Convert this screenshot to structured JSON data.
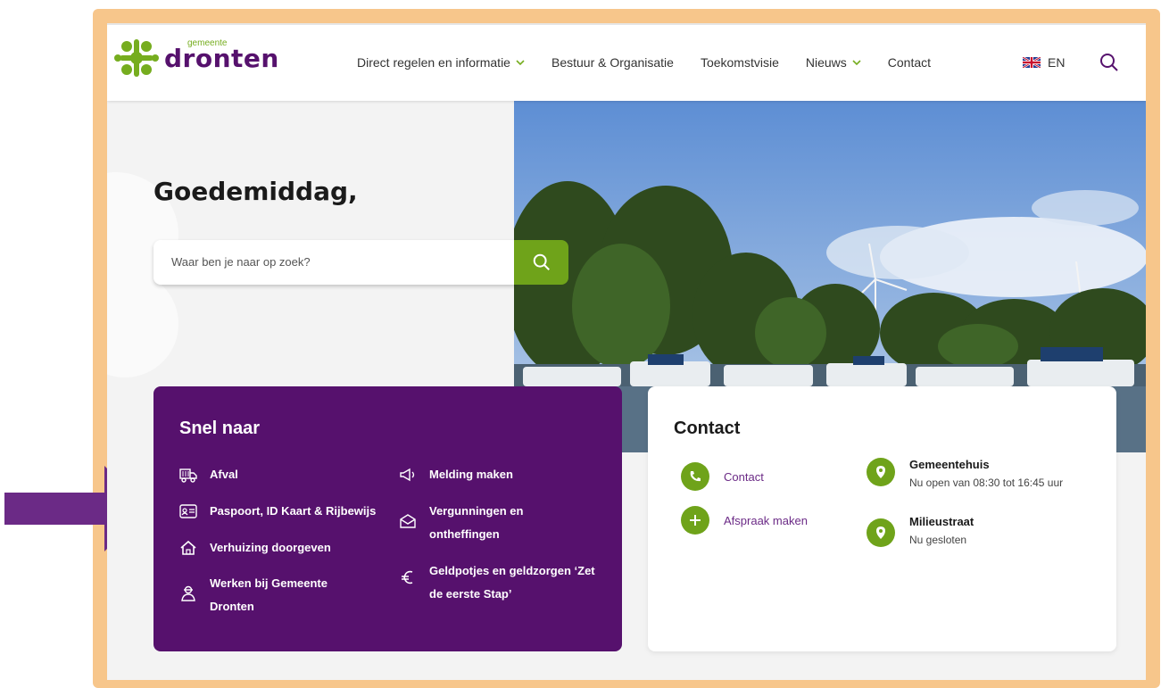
{
  "brand": {
    "small": "gemeente",
    "name": "dronten",
    "green": "#76ad1f",
    "purple": "#56116d"
  },
  "nav": {
    "items": [
      {
        "label": "Direct regelen en informatie",
        "dropdown": true
      },
      {
        "label": "Bestuur & Organisatie",
        "dropdown": false
      },
      {
        "label": "Toekomstvisie",
        "dropdown": false
      },
      {
        "label": "Nieuws",
        "dropdown": true
      },
      {
        "label": "Contact",
        "dropdown": false
      }
    ],
    "language": "EN",
    "search_icon": "search-icon"
  },
  "hero": {
    "greeting": "Goedemiddag,",
    "search_placeholder": "Waar ben je naar op zoek?"
  },
  "snel": {
    "title": "Snel naar",
    "left": [
      {
        "label": "Afval",
        "icon": "truck-icon"
      },
      {
        "label": "Paspoort, ID Kaart & Rijbewijs",
        "icon": "id-card-icon"
      },
      {
        "label": "Verhuizing doorgeven",
        "icon": "home-icon"
      },
      {
        "label_line1": "Werken bij Gemeente",
        "label_line2": "Dronten",
        "icon": "worker-icon"
      }
    ],
    "right": [
      {
        "label": "Melding maken",
        "icon": "megaphone-icon"
      },
      {
        "label_line1": "Vergunningen en",
        "label_line2": "ontheffingen",
        "icon": "envelope-icon"
      },
      {
        "label_line1": "Geldpotjes en geldzorgen ‘Zet",
        "label_line2": "de eerste Stap’",
        "icon": "euro-icon"
      }
    ]
  },
  "contact": {
    "title": "Contact",
    "links": [
      {
        "label": "Contact",
        "icon": "phone-icon"
      },
      {
        "label": "Afspraak maken",
        "icon": "plus-icon"
      }
    ],
    "locations": [
      {
        "title": "Gemeentehuis",
        "status": "Nu open van 08:30 tot 16:45 uur",
        "icon": "location-pin-icon"
      },
      {
        "title": "Milieustraat",
        "status": "Nu gesloten",
        "icon": "location-pin-icon"
      }
    ]
  },
  "annotation": {
    "arrow_color": "#6b2a86",
    "frame_color": "#f7c68b"
  }
}
